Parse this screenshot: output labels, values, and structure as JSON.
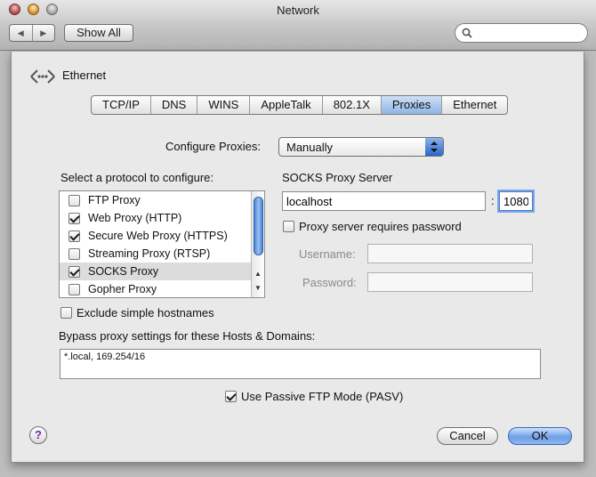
{
  "window": {
    "title": "Network"
  },
  "toolbar": {
    "back": "◀",
    "forward": "▶",
    "show_all": "Show All",
    "search_placeholder": ""
  },
  "interface": {
    "name": "Ethernet"
  },
  "tabs": [
    {
      "label": "TCP/IP",
      "selected": false
    },
    {
      "label": "DNS",
      "selected": false
    },
    {
      "label": "WINS",
      "selected": false
    },
    {
      "label": "AppleTalk",
      "selected": false
    },
    {
      "label": "802.1X",
      "selected": false
    },
    {
      "label": "Proxies",
      "selected": true
    },
    {
      "label": "Ethernet",
      "selected": false
    }
  ],
  "configure": {
    "label": "Configure Proxies:",
    "value": "Manually"
  },
  "protocols": {
    "label": "Select a protocol to configure:",
    "items": [
      {
        "label": "FTP Proxy",
        "checked": false,
        "selected": false
      },
      {
        "label": "Web Proxy (HTTP)",
        "checked": true,
        "selected": false
      },
      {
        "label": "Secure Web Proxy (HTTPS)",
        "checked": true,
        "selected": false
      },
      {
        "label": "Streaming Proxy (RTSP)",
        "checked": false,
        "selected": false
      },
      {
        "label": "SOCKS Proxy",
        "checked": true,
        "selected": true
      },
      {
        "label": "Gopher Proxy",
        "checked": false,
        "selected": false
      }
    ]
  },
  "server": {
    "label": "SOCKS Proxy Server",
    "host": "localhost",
    "separator": ":",
    "port": "1080",
    "requires_password_label": "Proxy server requires password",
    "requires_password": false,
    "username_label": "Username:",
    "username": "",
    "password_label": "Password:",
    "password": ""
  },
  "exclude_simple": {
    "label": "Exclude simple hostnames",
    "checked": false
  },
  "bypass": {
    "label": "Bypass proxy settings for these Hosts & Domains:",
    "value": "*.local, 169.254/16"
  },
  "passive_ftp": {
    "label": "Use Passive FTP Mode (PASV)",
    "checked": true
  },
  "buttons": {
    "help": "?",
    "cancel": "Cancel",
    "ok": "OK"
  }
}
